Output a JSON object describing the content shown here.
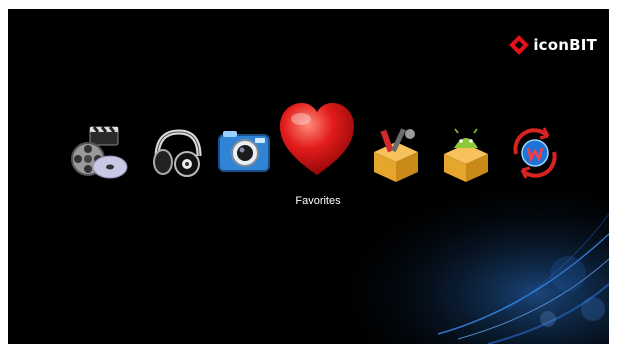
{
  "brand": {
    "name": "iconBIT",
    "logo_color": "#e4101a"
  },
  "menu": {
    "items": [
      {
        "id": "movies",
        "icon": "film-reel-clapper-icon"
      },
      {
        "id": "music",
        "icon": "headphones-icon"
      },
      {
        "id": "photos",
        "icon": "camera-icon"
      },
      {
        "id": "favorites",
        "icon": "heart-icon",
        "label": "Favorites",
        "selected": true
      },
      {
        "id": "settings",
        "icon": "toolbox-icon"
      },
      {
        "id": "apps",
        "icon": "android-box-icon"
      },
      {
        "id": "web",
        "icon": "web-sync-icon"
      }
    ],
    "focused_label": "Favorites"
  },
  "colors": {
    "background": "#000000",
    "accent": "#1e73d8",
    "heart": "#e21b1b"
  }
}
